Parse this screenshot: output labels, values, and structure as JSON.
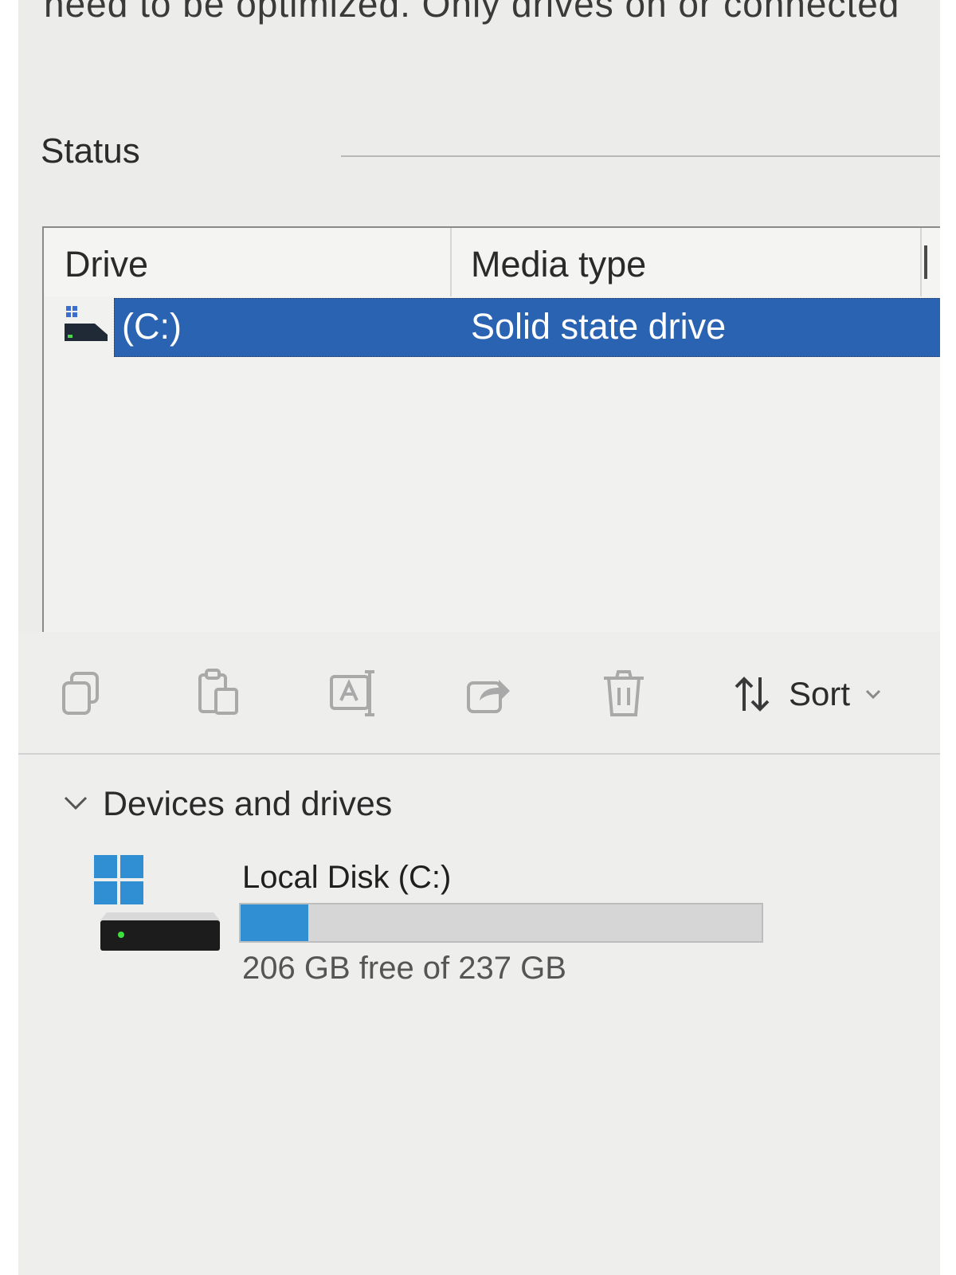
{
  "optimize_drives": {
    "cut_off_text": "need to be optimized. Only drives on or connected",
    "status_label": "Status",
    "columns": [
      "Drive",
      "Media type"
    ],
    "rows": [
      {
        "drive": "(C:)",
        "media_type": "Solid state drive",
        "selected": true
      }
    ]
  },
  "explorer": {
    "toolbar": {
      "icons": [
        "copy-icon",
        "paste-icon",
        "rename-icon",
        "share-icon",
        "delete-icon"
      ],
      "sort_label": "Sort"
    },
    "section_title": "Devices and drives",
    "drives": [
      {
        "name": "Local Disk (C:)",
        "free_text": "206 GB free of 237 GB",
        "used_fraction": 0.13
      }
    ]
  },
  "colors": {
    "selection": "#2b63b3",
    "usage_fill": "#2f8fd2",
    "windows_logo": "#2f8fd2"
  }
}
